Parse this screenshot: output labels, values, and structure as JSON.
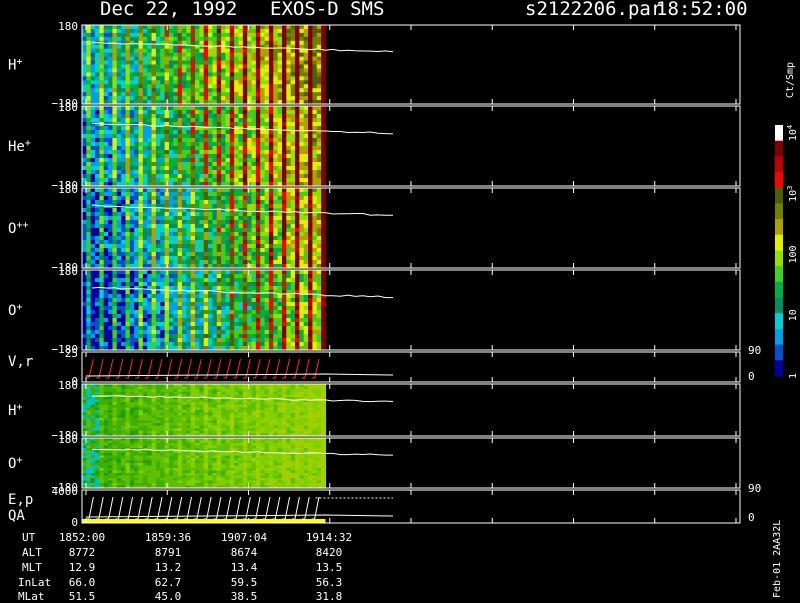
{
  "header": {
    "date": "Dec 22, 1992",
    "mission": "EXOS-D SMS",
    "file": "s2122206.par",
    "time": "18:52:00"
  },
  "colors": {
    "background": "#000000",
    "frame": "#ffffff",
    "trace": "#ffffff",
    "velocity_trace": "#ff2a2a",
    "qa_bar": "#ffff00"
  },
  "chart_data": {
    "type": "heatmap",
    "panels": [
      {
        "id": "h-plus-1",
        "ion": "H",
        "charge": "+",
        "ytop": "180",
        "ybot": "−180",
        "palette": "spectrum"
      },
      {
        "id": "he-plus",
        "ion": "He",
        "charge": "+",
        "ytop": "180",
        "ybot": "−180",
        "palette": "spectrum"
      },
      {
        "id": "o-plusplus",
        "ion": "O",
        "charge": "++",
        "ytop": "180",
        "ybot": "−180",
        "palette": "spectrum"
      },
      {
        "id": "o-plus-1",
        "ion": "O",
        "charge": "+",
        "ytop": "180",
        "ybot": "−180",
        "palette": "spectrum"
      },
      {
        "id": "vr",
        "ion": "V,r",
        "charge": "",
        "ytop": "25",
        "ybot": "0",
        "rtop": "90",
        "rbot": "0",
        "palette": "line"
      },
      {
        "id": "h-plus-2",
        "ion": "H",
        "charge": "+",
        "ytop": "180",
        "ybot": "−180",
        "palette": "green"
      },
      {
        "id": "o-plus-2",
        "ion": "O",
        "charge": "+",
        "ytop": "180",
        "ybot": "−180",
        "palette": "green"
      },
      {
        "id": "ep",
        "ion": "E,p",
        "charge": "",
        "ion2": "QA",
        "ytop": "4000",
        "ybot": "0",
        "rtop": "90",
        "rbot": "0",
        "palette": "line"
      }
    ],
    "colorbar": {
      "label": "Ct/Smp",
      "ticks": [
        {
          "base": "10",
          "exp": "4",
          "value": 10000
        },
        {
          "base": "10",
          "exp": "3",
          "value": 1000
        },
        {
          "base": "100",
          "exp": "",
          "value": 100
        },
        {
          "base": "10",
          "exp": "",
          "value": 10
        },
        {
          "base": "1",
          "exp": "",
          "value": 1
        }
      ],
      "colors": [
        "#0000a0",
        "#0050d0",
        "#00a0e8",
        "#00d0d0",
        "#009060",
        "#00b040",
        "#40d020",
        "#90e000",
        "#e0f000",
        "#b0a000",
        "#708000",
        "#506000",
        "#ff0000",
        "#c00000",
        "#800000",
        "#ffffff"
      ]
    },
    "x_axis": {
      "labels": [
        "UT",
        "ALT",
        "MLT",
        "InLat",
        "MLat"
      ],
      "columns": [
        {
          "ut": "1852:00",
          "alt": "8772",
          "mlt": "12.9",
          "inlat": "66.0",
          "mlat": "51.5"
        },
        {
          "ut": "1859:36",
          "alt": "8791",
          "mlt": "13.2",
          "inlat": "62.7",
          "mlat": "45.0"
        },
        {
          "ut": "1907:04",
          "alt": "8674",
          "mlt": "13.4",
          "inlat": "59.5",
          "mlat": "38.5"
        },
        {
          "ut": "1914:32",
          "alt": "8420",
          "mlt": "13.5",
          "inlat": "56.3",
          "mlat": "31.8"
        }
      ],
      "data_coverage": 0.37
    }
  },
  "side_label": "Feb-01 2AA32L"
}
